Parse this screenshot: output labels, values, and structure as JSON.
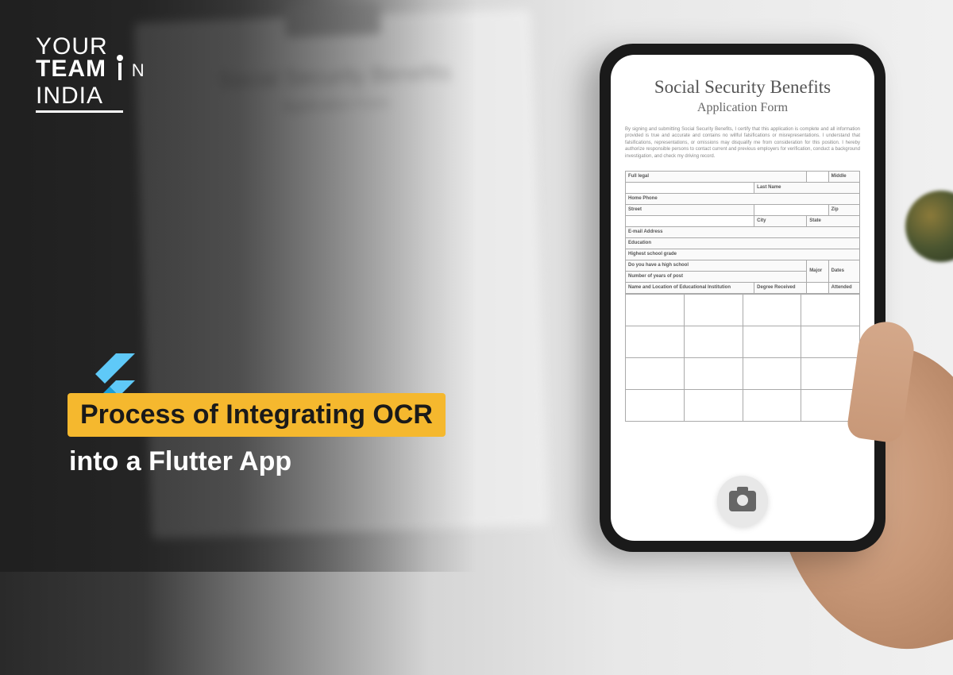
{
  "logo": {
    "line1": "YOUR",
    "line2": "TEAM",
    "line3": "INDIA"
  },
  "headline": {
    "highlighted": "Process of Integrating OCR",
    "plain": "into a Flutter App"
  },
  "phone_document": {
    "title": "Social Security Benefits",
    "subtitle": "Application Form",
    "disclaimer": "By signing and submitting Social Security Benefits, I certify that this application is complete and all information provided is true and accurate and contains no willful falsifications or misrepresentations. I understand that falsifications, representations, or omissions may disqualify me from consideration for this position. I hereby authorize responsible persons to contact current and previous employers for verification, conduct a background investigation, and check my driving record.",
    "fields": {
      "full_legal": "Full legal",
      "last_name": "Last Name",
      "middle": "Middle",
      "home_phone": "Home Phone",
      "street": "Street",
      "zip": "Zip",
      "city": "City",
      "state": "State",
      "email_address": "E-mail Address",
      "education": "Education",
      "highest_grade": "Highest school grade",
      "high_school": "Do you have a high school",
      "years_post": "Number of years of post",
      "institution": "Name and Location of Educational Institution",
      "degree": "Degree Received",
      "major": "Major",
      "dates": "Dates",
      "attended": "Attended"
    }
  },
  "bg_document": {
    "title": "Social Security Benefits",
    "subtitle": "Application Form"
  },
  "icons": {
    "flutter": "flutter-logo-icon",
    "camera": "camera-icon",
    "person": "person-icon"
  },
  "colors": {
    "highlight": "#f5b82e",
    "flutter_light": "#5fc9f8",
    "flutter_dark": "#075b9a"
  }
}
